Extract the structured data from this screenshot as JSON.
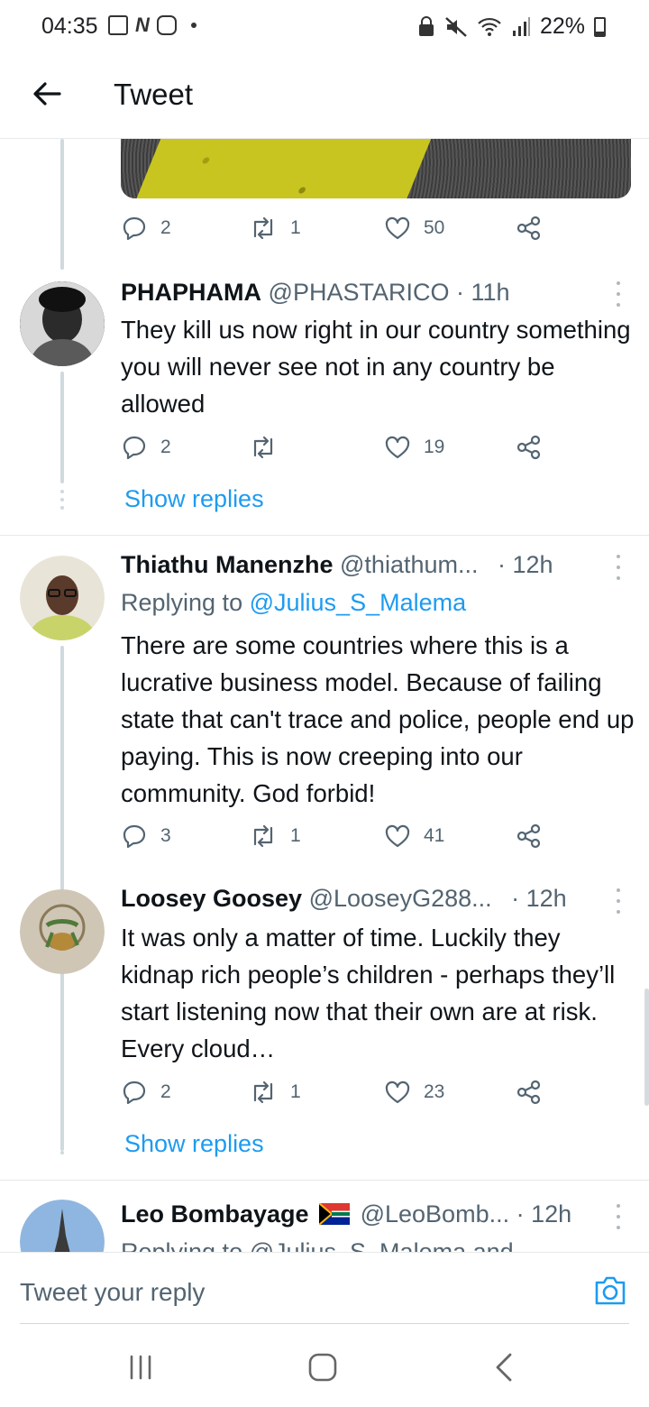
{
  "status_bar": {
    "time": "04:35",
    "battery": "22%"
  },
  "header": {
    "title": "Tweet"
  },
  "top_tweet_actions": {
    "replies": "2",
    "retweets": "1",
    "likes": "50"
  },
  "tweets": [
    {
      "name": "PHAPHAMA",
      "handle": "@PHASTARICO",
      "time": "· 11h",
      "text": "They kill us now right in our country something you will never see not in any country be allowed",
      "replies": "2",
      "retweets": "",
      "likes": "19",
      "show_replies": "Show replies"
    },
    {
      "name": "Thiathu Manenzhe",
      "handle": "@thiathum...",
      "time": "· 12h",
      "replying_label": "Replying to",
      "replying_to": "@Julius_S_Malema",
      "text": "There are some countries where this is a lucrative business model. Because of failing state that can't trace and police, people end up paying. This is now creeping into our community. God forbid!",
      "replies": "3",
      "retweets": "1",
      "likes": "41"
    },
    {
      "name": "Loosey Goosey",
      "handle": "@LooseyG288...",
      "time": "· 12h",
      "text": "It was only a matter of time. Luckily they kidnap rich people’s children - perhaps they’ll start listening now that their own are at risk. Every cloud…",
      "replies": "2",
      "retweets": "1",
      "likes": "23",
      "show_replies": "Show replies"
    },
    {
      "name": "Leo Bombayage",
      "handle": "@LeoBomb...",
      "time": "· 12h",
      "replying_partial": "Replying to @Julius_S_Malema and"
    }
  ],
  "reply_bar": {
    "placeholder": "Tweet your reply"
  },
  "colors": {
    "accent": "#1d9bf0",
    "text": "#0f1419",
    "muted": "#536471",
    "divider": "#e7e9ea"
  }
}
